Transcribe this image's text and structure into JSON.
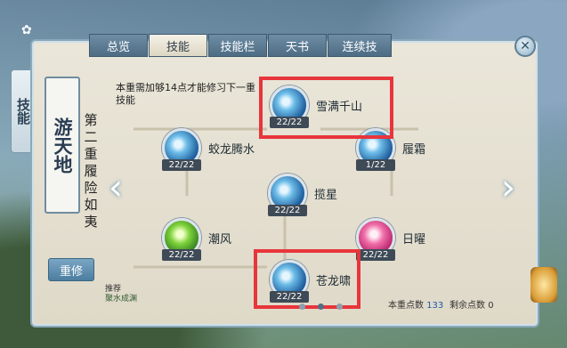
{
  "tabs": [
    {
      "label": "总览",
      "active": false
    },
    {
      "label": "技能",
      "active": true
    },
    {
      "label": "技能栏",
      "active": false
    },
    {
      "label": "天书",
      "active": false
    },
    {
      "label": "连续技",
      "active": false
    }
  ],
  "side_tab": {
    "label": "技能"
  },
  "school": {
    "name": "游天地"
  },
  "stage_title": "第二重履险如夷",
  "reset_button": "重修",
  "requirement_text": "本重需加够14点才能修习下一重技能",
  "skills": [
    {
      "name": "雪满千山",
      "level": "22/22",
      "icon": "ice-skill-icon"
    },
    {
      "name": "蛟龙腾水",
      "level": "22/22",
      "icon": "ice-skill-icon"
    },
    {
      "name": "履霜",
      "level": "1/22",
      "icon": "ice-skill-icon"
    },
    {
      "name": "揽星",
      "level": "22/22",
      "icon": "ice-skill-icon"
    },
    {
      "name": "潮风",
      "level": "22/22",
      "icon": "green-skill-icon"
    },
    {
      "name": "日曜",
      "level": "22/22",
      "icon": "pink-skill-icon"
    },
    {
      "name": "苍龙啸",
      "level": "22/22",
      "icon": "ice-skill-icon"
    }
  ],
  "recommend": {
    "line1": "推荐",
    "line2": "聚水成渊"
  },
  "points": {
    "label": "本重点数",
    "value": "133"
  },
  "remaining": {
    "label": "剩余点数",
    "value": "0"
  },
  "colors": {
    "highlight": "#e8353b",
    "panel": "#e6e1d2",
    "tab_active": "#f4f1e6"
  }
}
